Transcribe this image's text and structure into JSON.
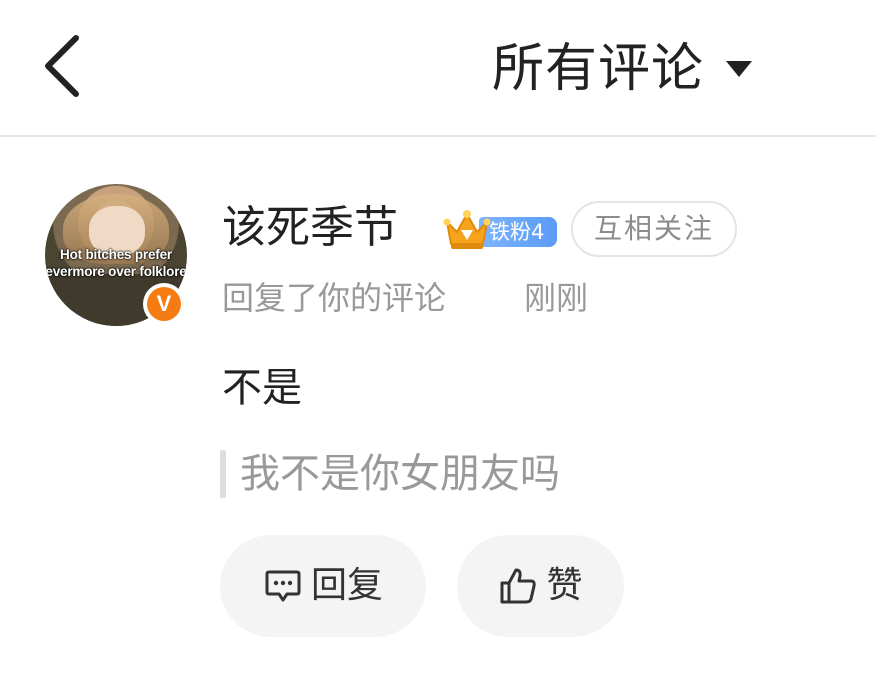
{
  "header": {
    "title": "所有评论"
  },
  "comment": {
    "username": "该死季节",
    "fan_badge": "铁粉4",
    "follow_label": "互相关注",
    "action_text": "回复了你的评论",
    "time": "刚刚",
    "avatar_caption_line1": "Hot bitches prefer",
    "avatar_caption_line2": "evermore over folklore",
    "verified_mark": "V",
    "text": "不是",
    "quoted_text": "我不是你女朋友吗"
  },
  "actions": {
    "reply_label": "回复",
    "like_label": "赞"
  },
  "colors": {
    "verified": "#f57c13",
    "fan_badge": "#6aa8fa",
    "muted_text": "#999999"
  },
  "icons": {
    "back": "chevron-left-icon",
    "dropdown": "caret-down-icon",
    "reply": "comment-icon",
    "like": "thumbs-up-icon",
    "fan": "crown-icon"
  }
}
